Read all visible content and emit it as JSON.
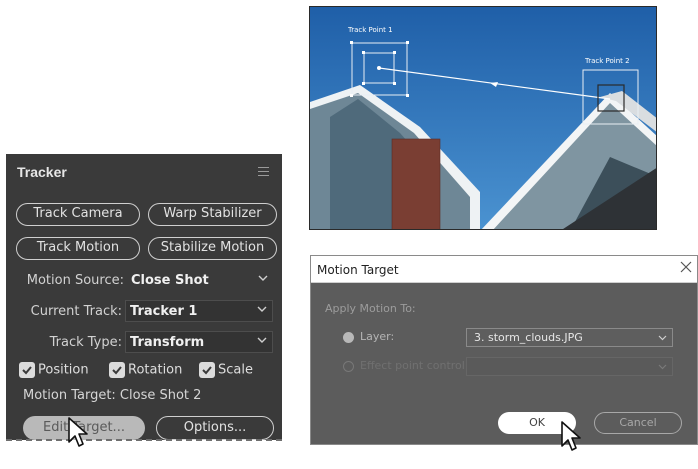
{
  "tracker": {
    "title": "Tracker",
    "buttons": {
      "track_camera": "Track Camera",
      "warp_stabilizer": "Warp Stabilizer",
      "track_motion": "Track Motion",
      "stabilize_motion": "Stabilize Motion"
    },
    "motion_source": {
      "label": "Motion Source:",
      "value": "Close Shot"
    },
    "current_track": {
      "label": "Current Track:",
      "value": "Tracker 1"
    },
    "track_type": {
      "label": "Track Type:",
      "value": "Transform"
    },
    "checkboxes": {
      "position": "Position",
      "rotation": "Rotation",
      "scale": "Scale"
    },
    "motion_target_text": "Motion Target: Close Shot 2",
    "edit_target": "Edit Target...",
    "options": "Options..."
  },
  "photo": {
    "track_point_1_label": "Track Point 1",
    "track_point_2_label": "Track Point 2"
  },
  "dialog": {
    "title": "Motion Target",
    "apply_label": "Apply Motion To:",
    "layer_label": "Layer:",
    "layer_value": "3. storm_clouds.JPG",
    "effect_label": "Effect point control",
    "ok": "OK",
    "cancel": "Cancel"
  }
}
